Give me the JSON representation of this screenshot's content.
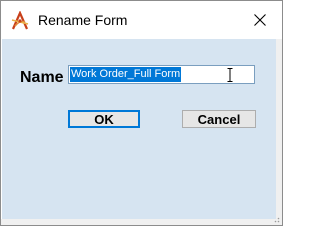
{
  "window": {
    "title": "Rename Form",
    "icon": "app-logo-icon",
    "close_icon": "close-icon"
  },
  "form": {
    "name_label": "Name",
    "name_value": "Work Order_Full Form"
  },
  "buttons": {
    "ok_label": "OK",
    "cancel_label": "Cancel"
  },
  "colors": {
    "content_background": "#d6e4f1",
    "selection": "#0078d7",
    "default_button_border": "#0078d7"
  }
}
